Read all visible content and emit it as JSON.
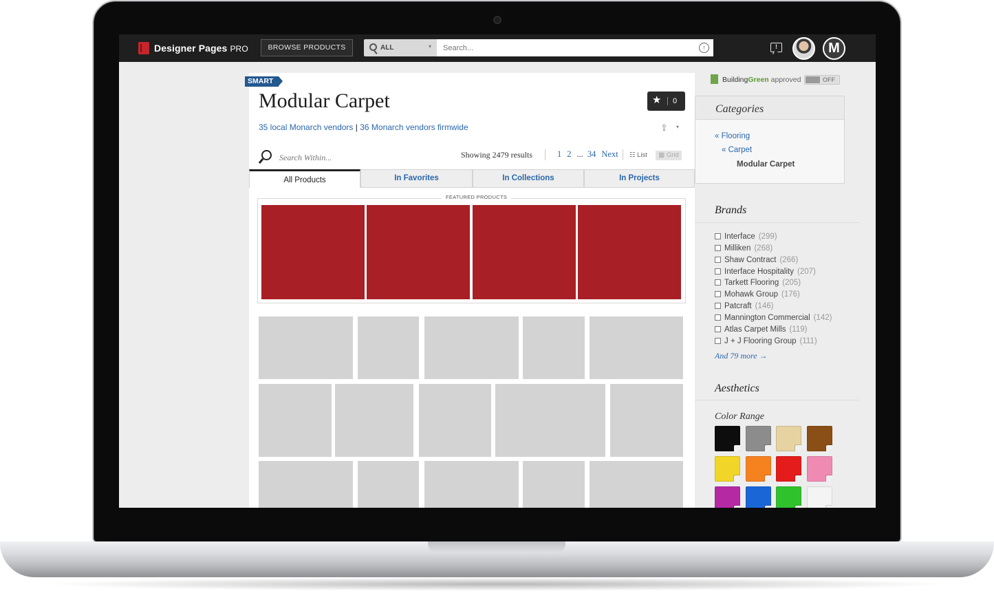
{
  "topbar": {
    "brand": "Designer Pages",
    "brand_suffix": "PRO",
    "browse_label": "BROWSE PRODUCTS",
    "scope_label": "ALL",
    "search_placeholder": "Search...",
    "feedback_glyph": "!",
    "org_initial": "M"
  },
  "product_page": {
    "badge": "SMART",
    "title": "Modular Carpet",
    "vendor_local": "35 local Monarch vendors",
    "vendor_separator": "|",
    "vendor_firmwide": "36 Monarch vendors firmwide",
    "favorite_count": "0",
    "search_within_placeholder": "Search Within...",
    "results_text": "Showing 2479 results",
    "pages": [
      "1",
      "2",
      "...",
      "34",
      "Next"
    ],
    "view_list": "List",
    "view_grid": "Grid",
    "tabs": [
      {
        "label": "All Products",
        "active": true
      },
      {
        "label": "In Favorites",
        "active": false
      },
      {
        "label": "In Collections",
        "active": false
      },
      {
        "label": "In Projects",
        "active": false
      }
    ],
    "featured_label": "FEATURED PRODUCTS",
    "featured_tile_color": "#a81f25",
    "placeholder_tile_color": "#d3d3d3"
  },
  "sidebar": {
    "buildinggreen": {
      "name_part1": "Building",
      "name_part2": "Green",
      "suffix": "approved",
      "toggle_label": "OFF"
    },
    "categories": {
      "title": "Categories",
      "links": [
        "« Flooring",
        "« Carpet"
      ],
      "current": "Modular Carpet"
    },
    "brands": {
      "title": "Brands",
      "items": [
        {
          "name": "Interface",
          "count": "(299)"
        },
        {
          "name": "Milliken",
          "count": "(268)"
        },
        {
          "name": "Shaw Contract",
          "count": "(266)"
        },
        {
          "name": "Interface Hospitality",
          "count": "(207)"
        },
        {
          "name": "Tarkett Flooring",
          "count": "(205)"
        },
        {
          "name": "Mohawk Group",
          "count": "(176)"
        },
        {
          "name": "Patcraft",
          "count": "(146)"
        },
        {
          "name": "Mannington Commercial",
          "count": "(142)"
        },
        {
          "name": "Atlas Carpet Mills",
          "count": "(119)"
        },
        {
          "name": "J + J Flooring Group",
          "count": "(111)"
        }
      ],
      "more": "And 79 more →"
    },
    "aesthetics": {
      "title": "Aesthetics",
      "color_range_title": "Color Range",
      "colors": [
        "#0d0d0d",
        "#8c8c8c",
        "#e6d3a1",
        "#8a4f16",
        "#f1d529",
        "#f6821f",
        "#e51c1c",
        "#ef8bb3",
        "#b52aa3",
        "#1a66d6",
        "#2fc22c",
        "#f4f4f4"
      ]
    }
  }
}
